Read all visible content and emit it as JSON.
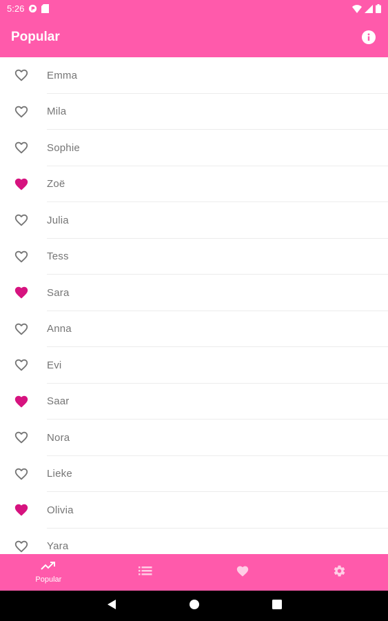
{
  "status_bar": {
    "time": "5:26"
  },
  "app_bar": {
    "title": "Popular"
  },
  "colors": {
    "primary": "#ff5aab",
    "favorite": "#d6137f",
    "outline": "#757575"
  },
  "names": [
    {
      "name": "Emma",
      "favorite": false
    },
    {
      "name": "Mila",
      "favorite": false
    },
    {
      "name": "Sophie",
      "favorite": false
    },
    {
      "name": "Zoë",
      "favorite": true
    },
    {
      "name": "Julia",
      "favorite": false
    },
    {
      "name": "Tess",
      "favorite": false
    },
    {
      "name": "Sara",
      "favorite": true
    },
    {
      "name": "Anna",
      "favorite": false
    },
    {
      "name": "Evi",
      "favorite": false
    },
    {
      "name": "Saar",
      "favorite": true
    },
    {
      "name": "Nora",
      "favorite": false
    },
    {
      "name": "Lieke",
      "favorite": false
    },
    {
      "name": "Olivia",
      "favorite": true
    },
    {
      "name": "Yara",
      "favorite": false
    }
  ],
  "bottom_nav": {
    "items": [
      {
        "label": "Popular",
        "icon": "trending-up-icon",
        "active": true
      },
      {
        "label": "",
        "icon": "list-icon",
        "active": false
      },
      {
        "label": "",
        "icon": "heart-icon",
        "active": false
      },
      {
        "label": "",
        "icon": "gear-icon",
        "active": false
      }
    ]
  }
}
